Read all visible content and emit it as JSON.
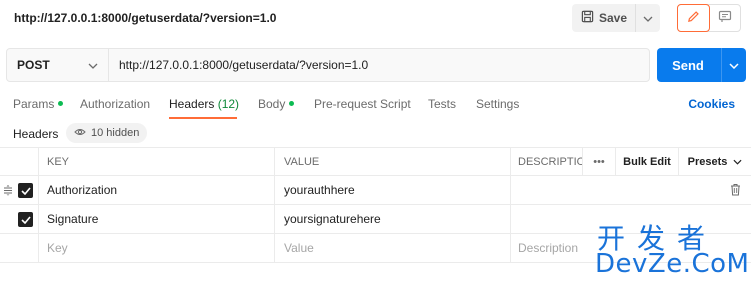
{
  "request": {
    "title": "http://127.0.0.1:8000/getuserdata/?version=1.0",
    "method": "POST",
    "url": "http://127.0.0.1:8000/getuserdata/?version=1.0"
  },
  "toolbar": {
    "save_label": "Save",
    "send_label": "Send"
  },
  "tabs": [
    {
      "label": "Params",
      "indicator": true
    },
    {
      "label": "Authorization"
    },
    {
      "label": "Headers",
      "count": "(12)",
      "active": true
    },
    {
      "label": "Body",
      "indicator": true
    },
    {
      "label": "Pre-request Script"
    },
    {
      "label": "Tests"
    },
    {
      "label": "Settings"
    }
  ],
  "cookies_label": "Cookies",
  "headers_section": {
    "label": "Headers",
    "hidden_label": "10 hidden"
  },
  "table": {
    "columns": {
      "key": "KEY",
      "value": "VALUE",
      "description": "DESCRIPTIO",
      "more": "•••",
      "bulk_edit": "Bulk Edit",
      "presets": "Presets"
    },
    "rows": [
      {
        "key": "Authorization",
        "value": "yourauthhere",
        "checked": true
      },
      {
        "key": "Signature",
        "value": "yoursignaturehere",
        "checked": true
      }
    ],
    "placeholders": {
      "key": "Key",
      "value": "Value",
      "description": "Description"
    }
  },
  "watermark": {
    "cn": "开发者",
    "en": "DevZe.CoM"
  },
  "colors": {
    "accent": "#ff6c37",
    "send": "#097bed",
    "link": "#0265d2",
    "indicator": "#0cbb52"
  }
}
